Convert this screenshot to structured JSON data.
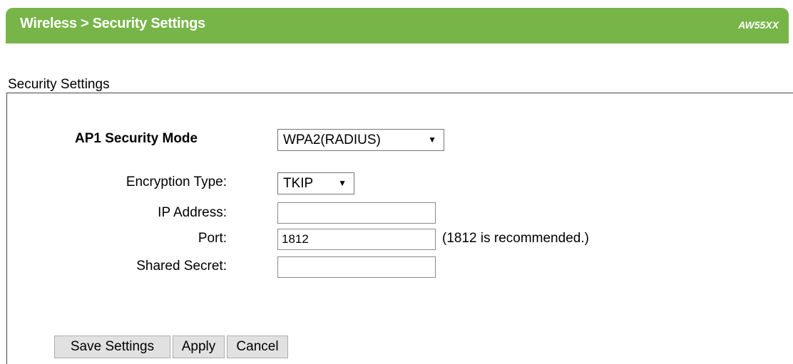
{
  "header": {
    "title": "Wireless > Security Settings",
    "model": "AW55XX",
    "bg_color": "#77b548"
  },
  "section": {
    "legend": "Security Settings"
  },
  "security_mode": {
    "label": "AP1 Security Mode",
    "value": "WPA2(RADIUS)",
    "arrow": "▼"
  },
  "encryption": {
    "label": "Encryption Type:",
    "value": "TKIP",
    "arrow": "▼"
  },
  "ip_address": {
    "label": "IP Address:",
    "value": ""
  },
  "port": {
    "label": "Port:",
    "value": "1812",
    "hint": "(1812 is recommended.)"
  },
  "shared_secret": {
    "label": "Shared Secret:",
    "value": ""
  },
  "buttons": {
    "save": "Save Settings",
    "apply": "Apply",
    "cancel": "Cancel"
  }
}
